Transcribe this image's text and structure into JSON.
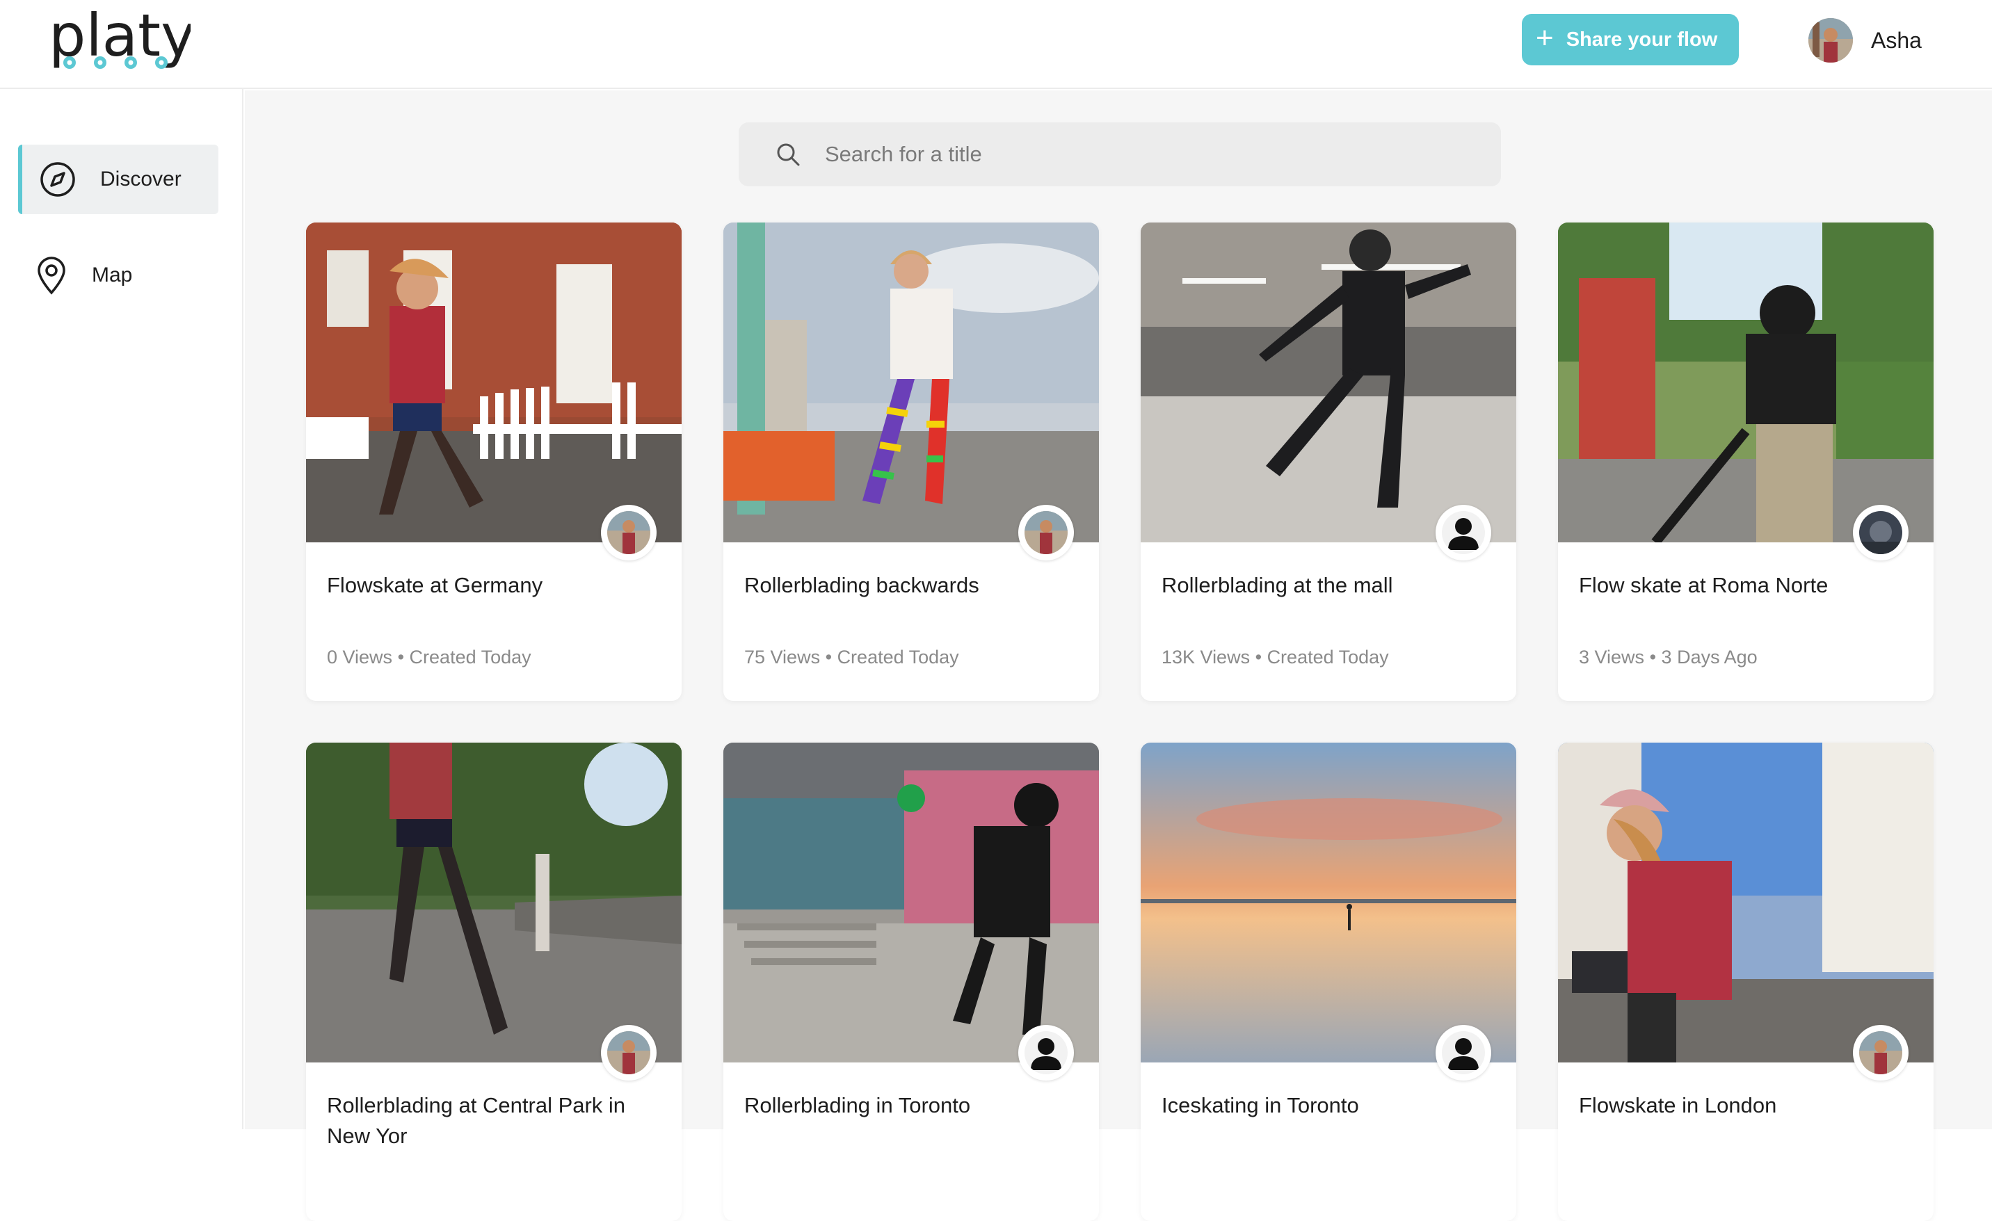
{
  "header": {
    "logo_text": "platy",
    "share_label": "Share your flow",
    "user_name": "Asha"
  },
  "sidebar": {
    "items": [
      {
        "label": "Discover",
        "icon": "compass-icon",
        "active": true
      },
      {
        "label": "Map",
        "icon": "map-pin-icon",
        "active": false
      }
    ]
  },
  "search": {
    "placeholder": "Search for a title",
    "value": ""
  },
  "colors": {
    "accent": "#5cc8d3",
    "background": "#f6f6f6"
  },
  "videos": [
    {
      "title": "Flowskate at Germany",
      "views": "0 Views",
      "age": "Created Today",
      "avatar": "photo"
    },
    {
      "title": "Rollerblading backwards",
      "views": "75 Views",
      "age": "Created Today",
      "avatar": "photo"
    },
    {
      "title": "Rollerblading at the mall",
      "views": "13K Views",
      "age": "Created Today",
      "avatar": "silhouette"
    },
    {
      "title": "Flow skate at Roma Norte",
      "views": "3 Views",
      "age": "3 Days Ago",
      "avatar": "photo"
    },
    {
      "title": "Rollerblading at Central Park in New Yor",
      "views": "",
      "age": "",
      "avatar": "photo"
    },
    {
      "title": "Rollerblading in Toronto",
      "views": "",
      "age": "",
      "avatar": "silhouette"
    },
    {
      "title": "Iceskating in Toronto",
      "views": "",
      "age": "",
      "avatar": "silhouette"
    },
    {
      "title": "Flowskate in London",
      "views": "",
      "age": "",
      "avatar": "photo"
    }
  ],
  "meta_separator": "•"
}
